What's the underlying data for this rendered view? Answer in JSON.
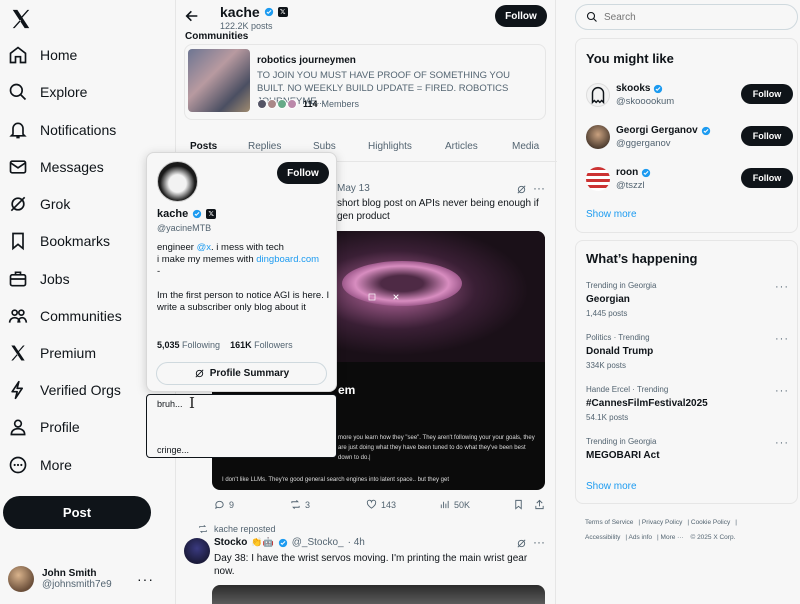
{
  "nav": {
    "items": [
      {
        "label": "Home",
        "icon": "home-icon"
      },
      {
        "label": "Explore",
        "icon": "search-icon"
      },
      {
        "label": "Notifications",
        "icon": "bell-icon"
      },
      {
        "label": "Messages",
        "icon": "mail-icon"
      },
      {
        "label": "Grok",
        "icon": "grok-icon"
      },
      {
        "label": "Bookmarks",
        "icon": "bookmark-icon"
      },
      {
        "label": "Jobs",
        "icon": "briefcase-icon"
      },
      {
        "label": "Communities",
        "icon": "people-icon"
      },
      {
        "label": "Premium",
        "icon": "x-logo-icon"
      },
      {
        "label": "Verified Orgs",
        "icon": "lightning-icon"
      },
      {
        "label": "Profile",
        "icon": "person-icon"
      },
      {
        "label": "More",
        "icon": "more-circle-icon"
      }
    ],
    "post_label": "Post",
    "me": {
      "name": "John Smith",
      "handle": "@johnsmith7e9"
    }
  },
  "header": {
    "name": "kache",
    "posts": "122.2K posts",
    "follow_label": "Follow"
  },
  "community": {
    "section_label": "Communities",
    "name": "robotics journeymen",
    "description": "TO JOIN YOU MUST HAVE PROOF OF SOMETHING YOU BUILT. NO WEEKLY BUILD UPDATE = FIRED. ROBOTICS JOURNEYME...",
    "members_count": "114",
    "members_label": "Members"
  },
  "tabs": [
    "Posts",
    "Replies",
    "Subs",
    "Highlights",
    "Articles",
    "Media"
  ],
  "tweet1": {
    "date": "May 13",
    "text": "short blog post on APIs never being enough if gen product",
    "media_title": "em",
    "media_p1": "more you learn how they \"see\". They aren't following your your goals, they are just doing what they have been tuned to do what they've been best down to do.|",
    "media_p2": "I don't like LLMs. They're good general search engines into latent space.. but they get",
    "replies": "9",
    "reposts": "3",
    "likes": "143",
    "views": "50K"
  },
  "tweet2": {
    "reposted_by": "kache reposted",
    "name": "Stocko",
    "handle": "@_Stocko_",
    "time": "· 4h",
    "text": "Day 38: I have the wrist servos moving.  I'm printing the main wrist gear now."
  },
  "hovercard": {
    "name": "kache",
    "handle": "@yacineMTB",
    "follow_label": "Follow",
    "bio_l1a": "engineer ",
    "bio_l1_link": "@x",
    "bio_l1b": ". i mess with tech",
    "bio_l2a": "i make my memes with ",
    "bio_l2_link": "dingboard.com",
    "bio_l3": "-",
    "bio_l4": "Im the first person to notice AGI is here. I write a subscriber only blog about it",
    "following_count": "5,035",
    "following_label": "Following",
    "followers_count": "161K",
    "followers_label": "Followers",
    "summary_label": "Profile Summary"
  },
  "compose": {
    "line1": "bruh...",
    "line2": "cringe..."
  },
  "search": {
    "placeholder": "Search"
  },
  "who_to_follow": {
    "title": "You might like",
    "users": [
      {
        "name": "skooks",
        "handle": "@skooookum",
        "follow": "Follow"
      },
      {
        "name": "Georgi Gerganov",
        "handle": "@ggerganov",
        "follow": "Follow"
      },
      {
        "name": "roon",
        "handle": "@tszzl",
        "follow": "Follow"
      }
    ],
    "show_more": "Show more"
  },
  "happening": {
    "title": "What’s happening",
    "trends": [
      {
        "context": "Trending in Georgia",
        "title": "Georgian",
        "count": "1,445 posts"
      },
      {
        "context": "Politics · Trending",
        "title": "Donald Trump",
        "count": "334K posts"
      },
      {
        "context": "Hande Ercel · Trending",
        "title": "#CannesFilmFestival2025",
        "count": "54.1K posts"
      },
      {
        "context": "Trending in Georgia",
        "title": "MEGOBARI Act",
        "count": ""
      }
    ],
    "show_more": "Show more"
  },
  "footer": {
    "terms": "Terms of Service",
    "privacy": "Privacy Policy",
    "cookie": "Cookie Policy",
    "accessibility": "Accessibility",
    "ads": "Ads info",
    "more": "More ···",
    "copyright": "© 2025 X Corp."
  },
  "colors": {
    "accent": "#1d9bf0",
    "text": "#0f1419",
    "muted": "#536471",
    "bg": "#f7f7f7"
  }
}
